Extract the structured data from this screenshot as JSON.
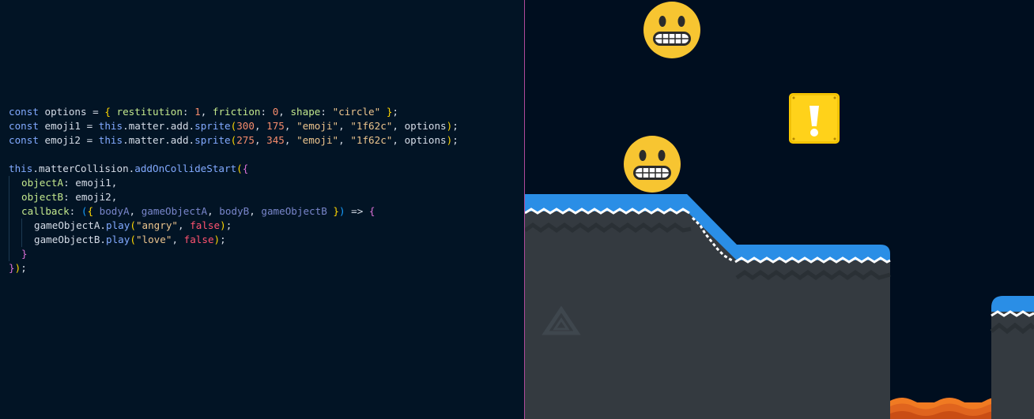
{
  "editor": {
    "lines": [
      [
        [
          "kw",
          "const "
        ],
        [
          "id",
          "options "
        ],
        [
          "punc",
          "= "
        ],
        [
          "b1",
          "{ "
        ],
        [
          "prop",
          "restitution"
        ],
        [
          "punc",
          ": "
        ],
        [
          "num",
          "1"
        ],
        [
          "punc",
          ", "
        ],
        [
          "prop",
          "friction"
        ],
        [
          "punc",
          ": "
        ],
        [
          "num",
          "0"
        ],
        [
          "punc",
          ", "
        ],
        [
          "prop",
          "shape"
        ],
        [
          "punc",
          ": "
        ],
        [
          "str",
          "\"circle\" "
        ],
        [
          "b1",
          "}"
        ],
        [
          "punc",
          ";"
        ]
      ],
      [
        [
          "kw",
          "const "
        ],
        [
          "id",
          "emoji1 "
        ],
        [
          "punc",
          "= "
        ],
        [
          "kw",
          "this"
        ],
        [
          "punc",
          "."
        ],
        [
          "id",
          "matter"
        ],
        [
          "punc",
          "."
        ],
        [
          "id",
          "add"
        ],
        [
          "punc",
          "."
        ],
        [
          "fn",
          "sprite"
        ],
        [
          "b1",
          "("
        ],
        [
          "num",
          "300"
        ],
        [
          "punc",
          ", "
        ],
        [
          "num",
          "175"
        ],
        [
          "punc",
          ", "
        ],
        [
          "str",
          "\"emoji\""
        ],
        [
          "punc",
          ", "
        ],
        [
          "str",
          "\"1f62c\""
        ],
        [
          "punc",
          ", "
        ],
        [
          "id",
          "options"
        ],
        [
          "b1",
          ")"
        ],
        [
          "punc",
          ";"
        ]
      ],
      [
        [
          "kw",
          "const "
        ],
        [
          "id",
          "emoji2 "
        ],
        [
          "punc",
          "= "
        ],
        [
          "kw",
          "this"
        ],
        [
          "punc",
          "."
        ],
        [
          "id",
          "matter"
        ],
        [
          "punc",
          "."
        ],
        [
          "id",
          "add"
        ],
        [
          "punc",
          "."
        ],
        [
          "fn",
          "sprite"
        ],
        [
          "b1",
          "("
        ],
        [
          "num",
          "275"
        ],
        [
          "punc",
          ", "
        ],
        [
          "num",
          "345"
        ],
        [
          "punc",
          ", "
        ],
        [
          "str",
          "\"emoji\""
        ],
        [
          "punc",
          ", "
        ],
        [
          "str",
          "\"1f62c\""
        ],
        [
          "punc",
          ", "
        ],
        [
          "id",
          "options"
        ],
        [
          "b1",
          ")"
        ],
        [
          "punc",
          ";"
        ]
      ],
      [],
      [
        [
          "kw",
          "this"
        ],
        [
          "punc",
          "."
        ],
        [
          "id",
          "matterCollision"
        ],
        [
          "punc",
          "."
        ],
        [
          "fn",
          "addOnCollideStart"
        ],
        [
          "b1",
          "("
        ],
        [
          "b2",
          "{"
        ]
      ],
      [
        [
          "guide",
          ""
        ],
        [
          "prop",
          "objectA"
        ],
        [
          "punc",
          ": "
        ],
        [
          "id",
          "emoji1"
        ],
        [
          "punc",
          ","
        ]
      ],
      [
        [
          "guide",
          ""
        ],
        [
          "prop",
          "objectB"
        ],
        [
          "punc",
          ": "
        ],
        [
          "id",
          "emoji2"
        ],
        [
          "punc",
          ","
        ]
      ],
      [
        [
          "guide",
          ""
        ],
        [
          "prop",
          "callback"
        ],
        [
          "punc",
          ": "
        ],
        [
          "b3",
          "("
        ],
        [
          "b1",
          "{ "
        ],
        [
          "param",
          "bodyA"
        ],
        [
          "punc",
          ", "
        ],
        [
          "param",
          "gameObjectA"
        ],
        [
          "punc",
          ", "
        ],
        [
          "param",
          "bodyB"
        ],
        [
          "punc",
          ", "
        ],
        [
          "param",
          "gameObjectB "
        ],
        [
          "b1",
          "}"
        ],
        [
          "b3",
          ")"
        ],
        [
          "punc",
          " => "
        ],
        [
          "b2",
          "{"
        ]
      ],
      [
        [
          "guide",
          ""
        ],
        [
          "guide",
          ""
        ],
        [
          "id",
          "gameObjectA"
        ],
        [
          "punc",
          "."
        ],
        [
          "fn",
          "play"
        ],
        [
          "b1",
          "("
        ],
        [
          "str",
          "\"angry\""
        ],
        [
          "punc",
          ", "
        ],
        [
          "bool",
          "false"
        ],
        [
          "b1",
          ")"
        ],
        [
          "punc",
          ";"
        ]
      ],
      [
        [
          "guide",
          ""
        ],
        [
          "guide",
          ""
        ],
        [
          "id",
          "gameObjectB"
        ],
        [
          "punc",
          "."
        ],
        [
          "fn",
          "play"
        ],
        [
          "b1",
          "("
        ],
        [
          "str",
          "\"love\""
        ],
        [
          "punc",
          ", "
        ],
        [
          "bool",
          "false"
        ],
        [
          "b1",
          ")"
        ],
        [
          "punc",
          ";"
        ]
      ],
      [
        [
          "guide",
          ""
        ],
        [
          "b2",
          "}"
        ]
      ],
      [
        [
          "b2",
          "}"
        ],
        [
          "b1",
          ")"
        ],
        [
          "punc",
          ";"
        ]
      ]
    ]
  },
  "game": {
    "sprites": [
      {
        "name": "grimacing-emoji-top",
        "icon": "grimacing-face"
      },
      {
        "name": "grimacing-emoji-ground",
        "icon": "grimacing-face"
      },
      {
        "name": "question-block",
        "icon": "exclamation-block"
      }
    ],
    "colors": {
      "sky": "#000e1f",
      "grass": "#2a8ee6",
      "ground": "#343a40",
      "lava": "#f07a22",
      "emoji": "#f7c531",
      "block": "#ffcc00"
    }
  }
}
